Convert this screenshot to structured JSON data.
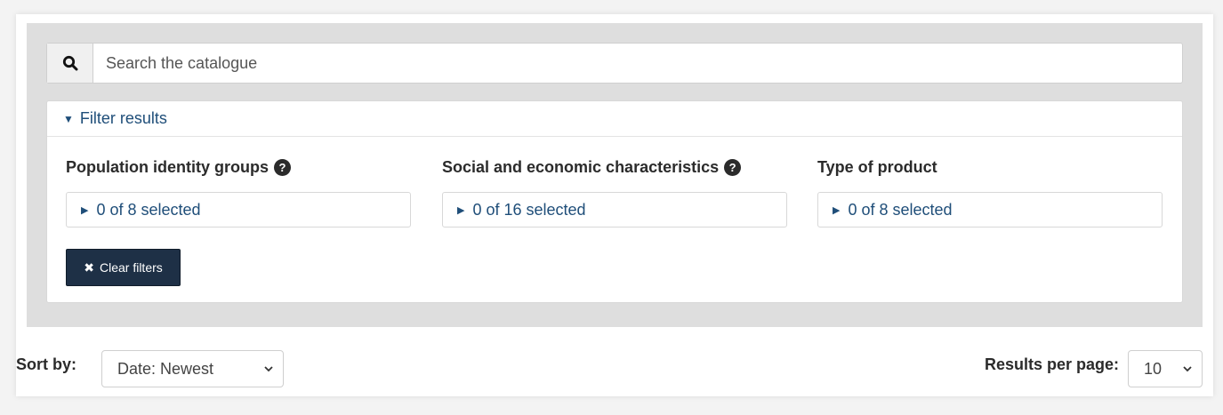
{
  "search": {
    "placeholder": "Search the catalogue",
    "icon": "search-icon"
  },
  "filters": {
    "header_label": "Filter results",
    "groups": [
      {
        "title": "Population identity groups",
        "has_help": true,
        "summary": "0 of 8 selected"
      },
      {
        "title": "Social and economic characteristics",
        "has_help": true,
        "summary": "0 of 16 selected"
      },
      {
        "title": "Type of product",
        "has_help": false,
        "summary": "0 of 8 selected"
      }
    ],
    "clear_label": "Clear filters"
  },
  "sort": {
    "label": "Sort by:",
    "selected": "Date: Newest"
  },
  "results_per_page": {
    "label": "Results per page:",
    "selected": "10"
  },
  "colors": {
    "panel_bg": "#dedede",
    "link_blue": "#1f4e79",
    "clear_button_bg": "#1e3046"
  }
}
